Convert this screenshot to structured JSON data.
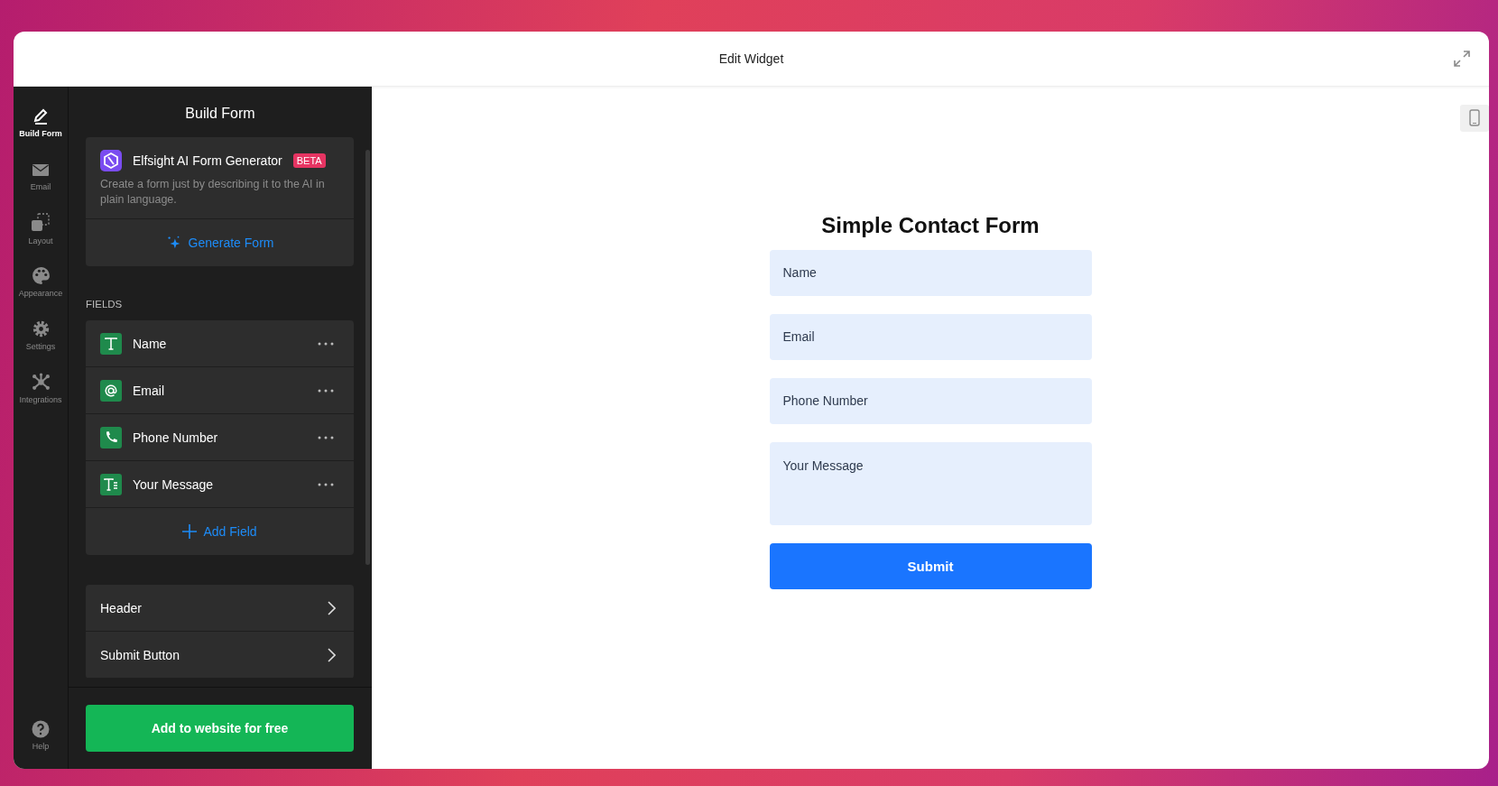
{
  "window": {
    "title": "Edit Widget"
  },
  "nav": [
    {
      "label": "Build Form",
      "kind": "pencil",
      "selected": true
    },
    {
      "label": "Email",
      "kind": "envelope",
      "selected": false
    },
    {
      "label": "Layout",
      "kind": "layout",
      "selected": false
    },
    {
      "label": "Appearance",
      "kind": "palette",
      "selected": false
    },
    {
      "label": "Settings",
      "kind": "gear",
      "selected": false
    },
    {
      "label": "Integrations",
      "kind": "network",
      "selected": false
    }
  ],
  "help": {
    "label": "Help"
  },
  "panel": {
    "title": "Build Form",
    "ai_card": {
      "title": "Elfsight AI Form Generator",
      "badge": "BETA",
      "description": "Create a form just by describing it to the AI in plain language.",
      "action": "Generate Form"
    },
    "fields_heading": "FIELDS",
    "fields": [
      {
        "label": "Name",
        "kind": "text"
      },
      {
        "label": "Email",
        "kind": "email"
      },
      {
        "label": "Phone Number",
        "kind": "phone"
      },
      {
        "label": "Your Message",
        "kind": "textarea"
      }
    ],
    "add_field": "Add Field",
    "sections": [
      "Header",
      "Submit Button"
    ],
    "cta": "Add to website for free"
  },
  "preview": {
    "title": "Simple Contact Form",
    "inputs": [
      {
        "placeholder": "Name",
        "kind": "input"
      },
      {
        "placeholder": "Email",
        "kind": "input"
      },
      {
        "placeholder": "Phone Number",
        "kind": "input"
      },
      {
        "placeholder": "Your Message",
        "kind": "textarea"
      }
    ],
    "submit": "Submit"
  }
}
